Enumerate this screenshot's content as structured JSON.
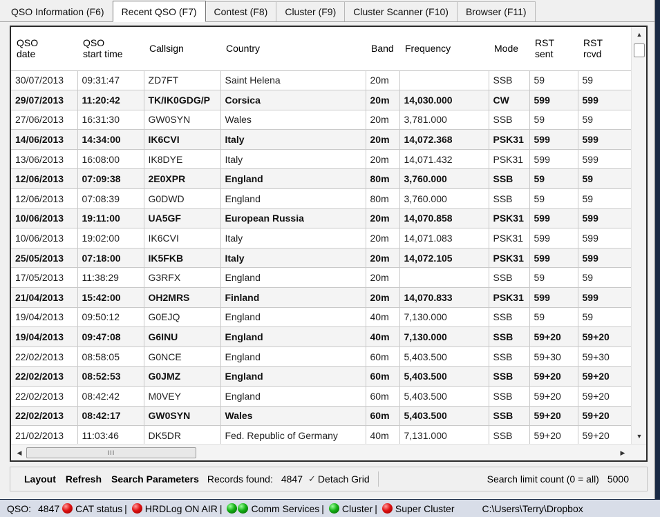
{
  "tabs": [
    {
      "label": "QSO Information (F6)"
    },
    {
      "label": "Recent QSO (F7)",
      "active": true
    },
    {
      "label": "Contest (F8)"
    },
    {
      "label": "Cluster (F9)"
    },
    {
      "label": "Cluster Scanner (F10)"
    },
    {
      "label": "Browser (F11)"
    }
  ],
  "grid": {
    "columns": [
      {
        "line1": "QSO",
        "line2": "date"
      },
      {
        "line1": "QSO",
        "line2": "start time"
      },
      {
        "line1": "Callsign",
        "line2": ""
      },
      {
        "line1": "Country",
        "line2": ""
      },
      {
        "line1": "Band",
        "line2": ""
      },
      {
        "line1": "Frequency",
        "line2": ""
      },
      {
        "line1": "Mode",
        "line2": ""
      },
      {
        "line1": "RST",
        "line2": "sent"
      },
      {
        "line1": "RST",
        "line2": "rcvd"
      }
    ],
    "rows": [
      [
        "30/07/2013",
        "09:31:47",
        "ZD7FT",
        "Saint Helena",
        "20m",
        "",
        "SSB",
        "59",
        "59"
      ],
      [
        "29/07/2013",
        "11:20:42",
        "TK/IK0GDG/P",
        "Corsica",
        "20m",
        "14,030.000",
        "CW",
        "599",
        "599"
      ],
      [
        "27/06/2013",
        "16:31:30",
        "GW0SYN",
        "Wales",
        "20m",
        "3,781.000",
        "SSB",
        "59",
        "59"
      ],
      [
        "14/06/2013",
        "14:34:00",
        "IK6CVI",
        "Italy",
        "20m",
        "14,072.368",
        "PSK31",
        "599",
        "599"
      ],
      [
        "13/06/2013",
        "16:08:00",
        "IK8DYE",
        "Italy",
        "20m",
        "14,071.432",
        "PSK31",
        "599",
        "599"
      ],
      [
        "12/06/2013",
        "07:09:38",
        "2E0XPR",
        "England",
        "80m",
        "3,760.000",
        "SSB",
        "59",
        "59"
      ],
      [
        "12/06/2013",
        "07:08:39",
        "G0DWD",
        "England",
        "80m",
        "3,760.000",
        "SSB",
        "59",
        "59"
      ],
      [
        "10/06/2013",
        "19:11:00",
        "UA5GF",
        "European Russia",
        "20m",
        "14,070.858",
        "PSK31",
        "599",
        "599"
      ],
      [
        "10/06/2013",
        "19:02:00",
        "IK6CVI",
        "Italy",
        "20m",
        "14,071.083",
        "PSK31",
        "599",
        "599"
      ],
      [
        "25/05/2013",
        "07:18:00",
        "IK5FKB",
        "Italy",
        "20m",
        "14,072.105",
        "PSK31",
        "599",
        "599"
      ],
      [
        "17/05/2013",
        "11:38:29",
        "G3RFX",
        "England",
        "20m",
        "",
        "SSB",
        "59",
        "59"
      ],
      [
        "21/04/2013",
        "15:42:00",
        "OH2MRS",
        "Finland",
        "20m",
        "14,070.833",
        "PSK31",
        "599",
        "599"
      ],
      [
        "19/04/2013",
        "09:50:12",
        "G0EJQ",
        "England",
        "40m",
        "7,130.000",
        "SSB",
        "59",
        "59"
      ],
      [
        "19/04/2013",
        "09:47:08",
        "G6INU",
        "England",
        "40m",
        "7,130.000",
        "SSB",
        "59+20",
        "59+20"
      ],
      [
        "22/02/2013",
        "08:58:05",
        "G0NCE",
        "England",
        "60m",
        "5,403.500",
        "SSB",
        "59+30",
        "59+30"
      ],
      [
        "22/02/2013",
        "08:52:53",
        "G0JMZ",
        "England",
        "60m",
        "5,403.500",
        "SSB",
        "59+20",
        "59+20"
      ],
      [
        "22/02/2013",
        "08:42:42",
        "M0VEY",
        "England",
        "60m",
        "5,403.500",
        "SSB",
        "59+20",
        "59+20"
      ],
      [
        "22/02/2013",
        "08:42:17",
        "GW0SYN",
        "Wales",
        "60m",
        "5,403.500",
        "SSB",
        "59+20",
        "59+20"
      ],
      [
        "21/02/2013",
        "11:03:46",
        "DK5DR",
        "Fed. Republic of Germany",
        "40m",
        "7,131.000",
        "SSB",
        "59+20",
        "59+20"
      ]
    ],
    "bold_rows": [
      1,
      3,
      5,
      7,
      9,
      11,
      13,
      15,
      17
    ],
    "hscroll_grip": "III"
  },
  "toolbar": {
    "layout_label": "Layout",
    "refresh_label": "Refresh",
    "search_params_label": "Search Parameters",
    "records_found_label": "Records found:",
    "records_found_value": "4847",
    "detach_grid_label": "Detach Grid",
    "search_limit_label": "Search limit count (0 = all)",
    "search_limit_value": "5000"
  },
  "statusbar": {
    "qso_label": "QSO:",
    "qso_count": "4847",
    "cat_status": "CAT status",
    "hrdlog": "HRDLog ON AIR",
    "comm_services": "Comm Services",
    "cluster": "Cluster",
    "super_cluster": "Super Cluster",
    "path": "C:\\Users\\Terry\\Dropbox",
    "colors": {
      "red_led": "#e01010",
      "green_led": "#15b015"
    }
  }
}
